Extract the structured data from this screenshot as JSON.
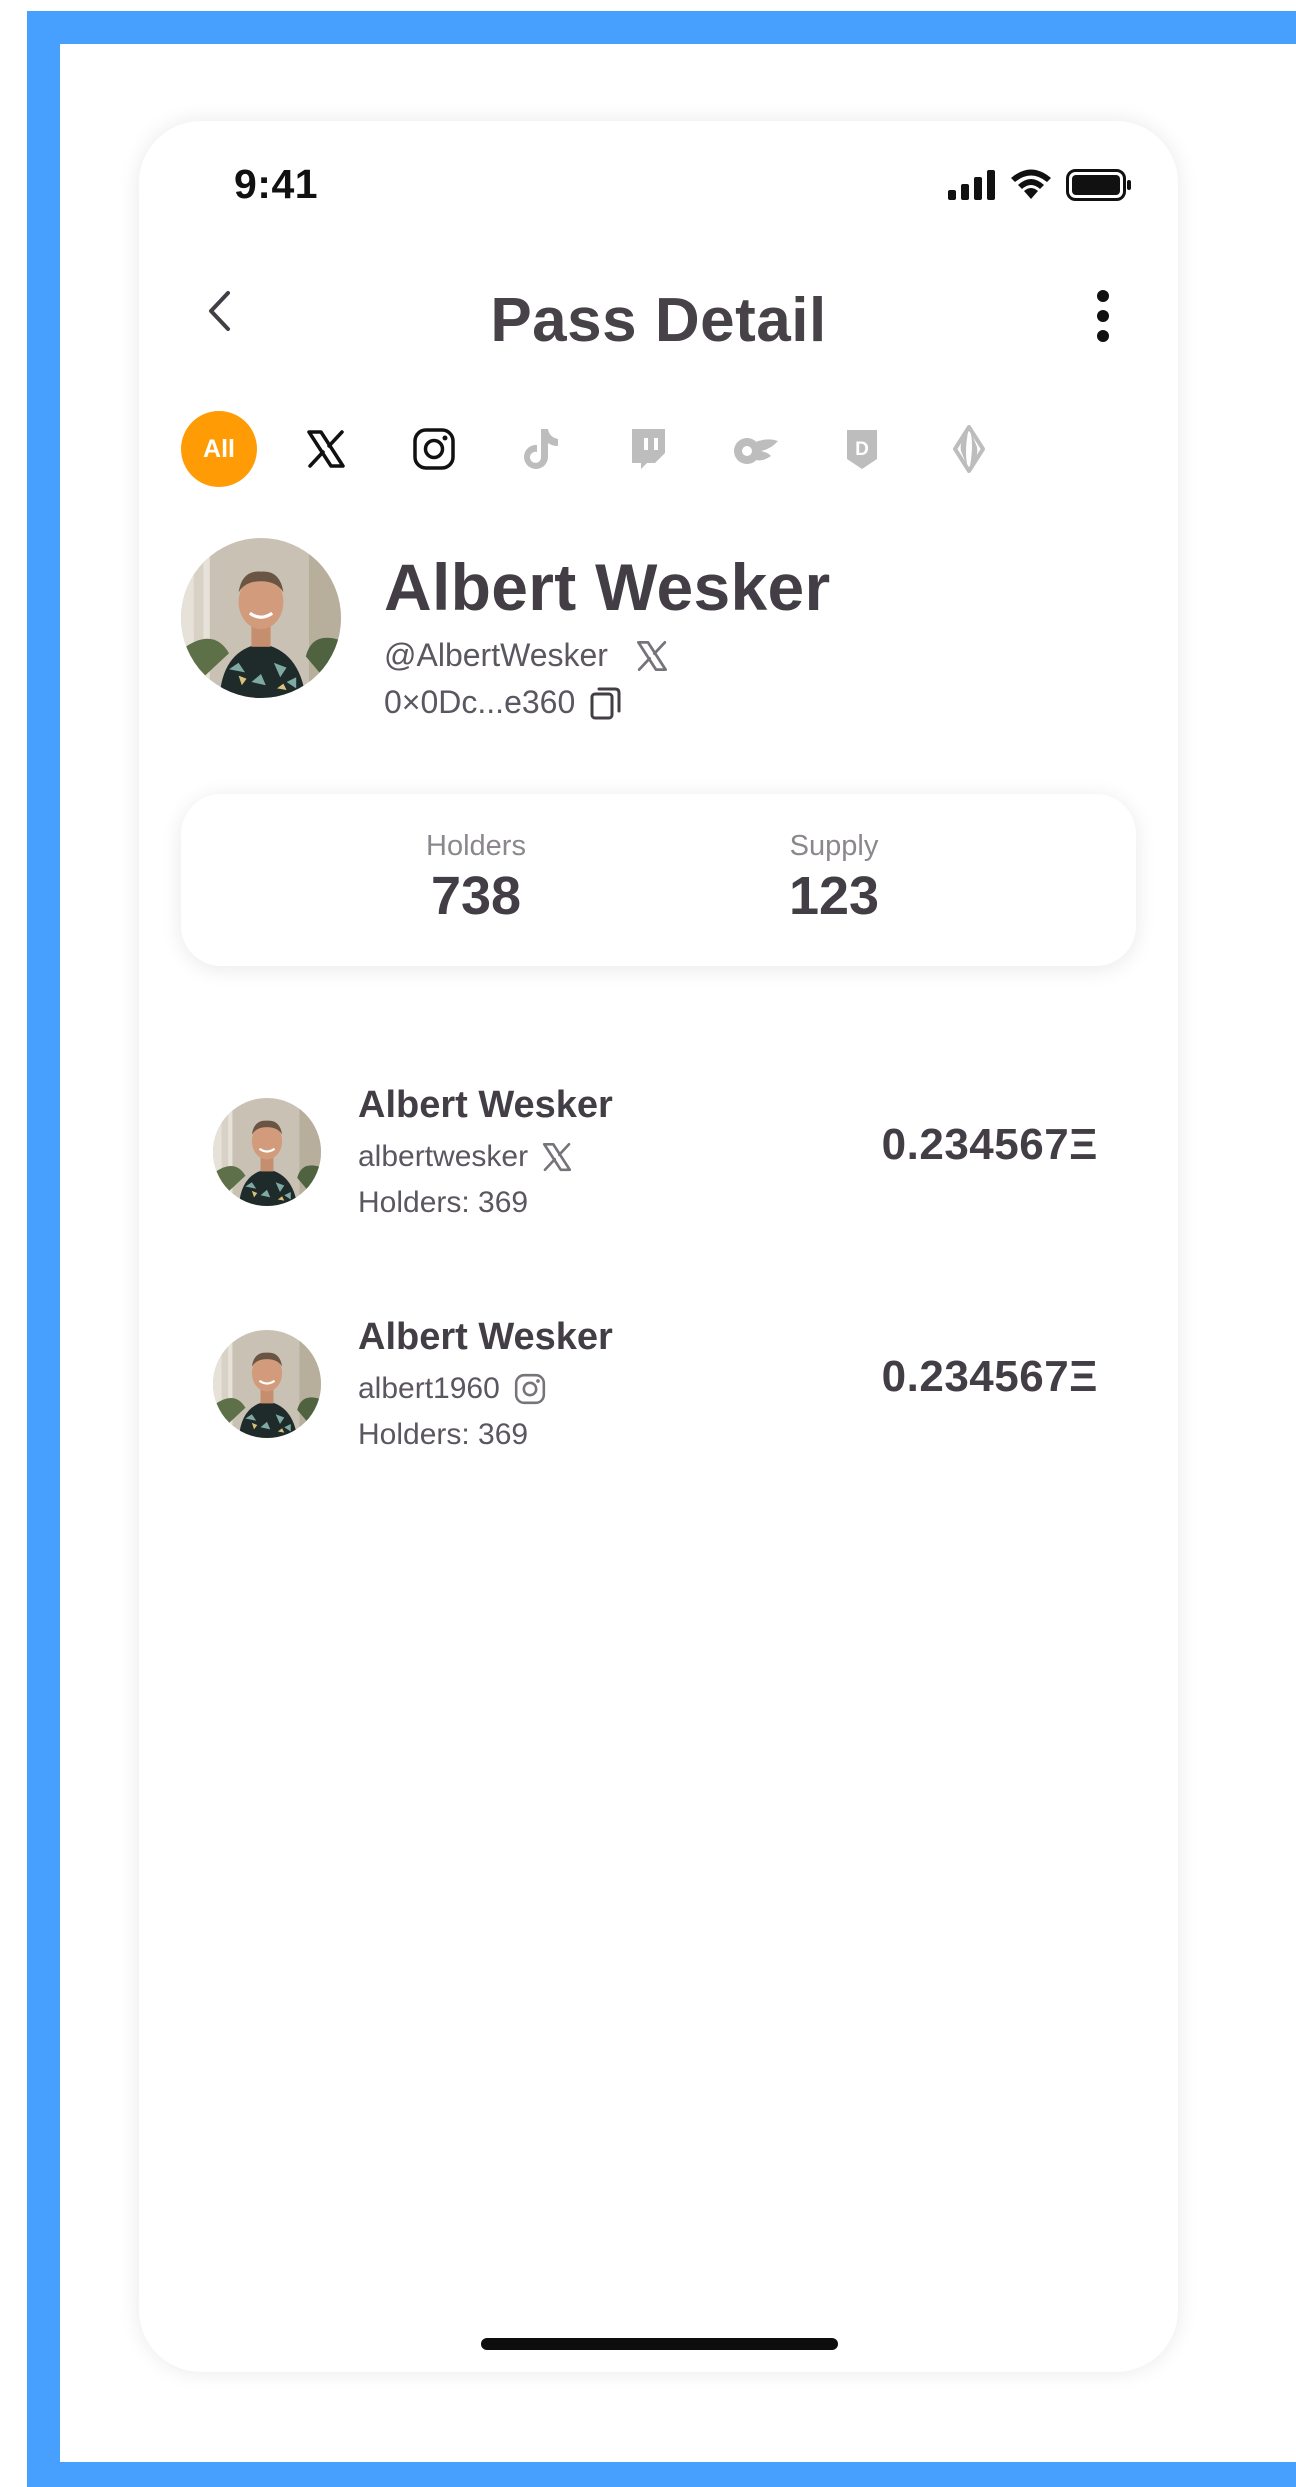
{
  "status_bar": {
    "time": "9:41"
  },
  "header": {
    "title": "Pass Detail"
  },
  "filters": [
    {
      "label": "All",
      "icon": "all",
      "active": true
    },
    {
      "label": "",
      "icon": "x-icon",
      "active": false
    },
    {
      "label": "",
      "icon": "instagram-icon",
      "active": false
    },
    {
      "label": "",
      "icon": "tiktok-icon",
      "active": false
    },
    {
      "label": "",
      "icon": "twitch-icon",
      "active": false
    },
    {
      "label": "",
      "icon": "onlyfans-icon",
      "active": false
    },
    {
      "label": "",
      "icon": "d-badge-icon",
      "active": false
    },
    {
      "label": "",
      "icon": "ens-icon",
      "active": false
    }
  ],
  "profile": {
    "name": "Albert Wesker",
    "handle": "@AlbertWesker",
    "address": "0×0Dc...e360"
  },
  "stats": [
    {
      "label": "Holders",
      "value": "738"
    },
    {
      "label": "Supply",
      "value": "123"
    }
  ],
  "passes": [
    {
      "name": "Albert Wesker",
      "handle": "albertwesker",
      "platform": "x-icon",
      "holders": "Holders: 369",
      "price": "0.234567Ξ"
    },
    {
      "name": "Albert Wesker",
      "handle": "albert1960",
      "platform": "instagram-icon",
      "holders": "Holders: 369",
      "price": "0.234567Ξ"
    }
  ],
  "colors": {
    "frame": "#47a0fd",
    "accent": "#ff9b05",
    "text": "#433e45",
    "muted": "#8b878d"
  }
}
